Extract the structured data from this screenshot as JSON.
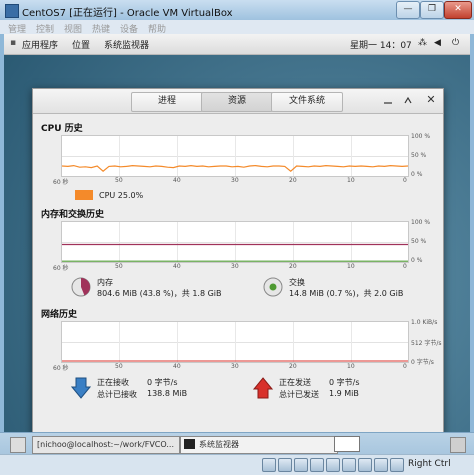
{
  "vbox": {
    "title": "CentOS7 [正在运行] - Oracle VM VirtualBox",
    "menu": [
      "管理",
      "控制",
      "视图",
      "热键",
      "设备",
      "帮助"
    ],
    "min_label": "—",
    "max_label": "❐",
    "close_label": "✕"
  },
  "gnome": {
    "apps": "应用程序",
    "places": "位置",
    "sysmon": "系统监视器",
    "clock": "星期一 14：07"
  },
  "sysmon": {
    "tabs": [
      "进程",
      "资源",
      "文件系统"
    ],
    "active_tab": 1,
    "cpu": {
      "title": "CPU 历史",
      "y_ticks": [
        "100 %",
        "50 %",
        "0 %"
      ],
      "x_ticks": [
        "60 秒",
        "50",
        "40",
        "30",
        "20",
        "10",
        "0"
      ],
      "legend": "CPU 25.0%",
      "color": "#f48a2a",
      "values": [
        25,
        24,
        26,
        22,
        23,
        21,
        25,
        12,
        24,
        25,
        23,
        24,
        26,
        25,
        24,
        23,
        25,
        24,
        22,
        21,
        25,
        24,
        26,
        24,
        25,
        23,
        24,
        25,
        25,
        23,
        24,
        22,
        25,
        26,
        24,
        23,
        25,
        25,
        24,
        12,
        25,
        24,
        23,
        25,
        24,
        26,
        25,
        24,
        23,
        25,
        24,
        25,
        24,
        23,
        25,
        24,
        26,
        25,
        24,
        25
      ]
    },
    "mem": {
      "title": "内存和交换历史",
      "y_ticks": [
        "100 %",
        "50 %",
        "0 %"
      ],
      "x_ticks": [
        "60 秒",
        "50",
        "40",
        "30",
        "20",
        "10",
        "0"
      ],
      "mem_label": "内存",
      "mem_value": "804.6 MiB (43.8 %)，共 1.8 GiB",
      "mem_color": "#a0325a",
      "mem_pct": 43.8,
      "swap_label": "交换",
      "swap_value": "14.8 MiB (0.7 %)，共 2.0 GiB",
      "swap_color": "#4e9a32",
      "swap_pct": 0.7
    },
    "net": {
      "title": "网络历史",
      "y_ticks": [
        "1.0 KiB/s",
        "512 字节/s",
        "0 字节/s"
      ],
      "x_ticks": [
        "60 秒",
        "50",
        "40",
        "30",
        "20",
        "10",
        "0"
      ],
      "recv_label": "正在接收",
      "recv_rate": "0 字节/s",
      "recv_total_label": "总计已接收",
      "recv_total": "138.8 MiB",
      "send_label": "正在发送",
      "send_rate": "0 字节/s",
      "send_total_label": "总计已发送",
      "send_total": "1.9 MiB",
      "recv_color": "#3a7fc4",
      "send_color": "#d8312b"
    }
  },
  "taskbar": {
    "terminal": "[nichoo@localhost:~/work/FVCO...",
    "sysmon": "系统监视器",
    "right_ctrl": "Right Ctrl"
  }
}
